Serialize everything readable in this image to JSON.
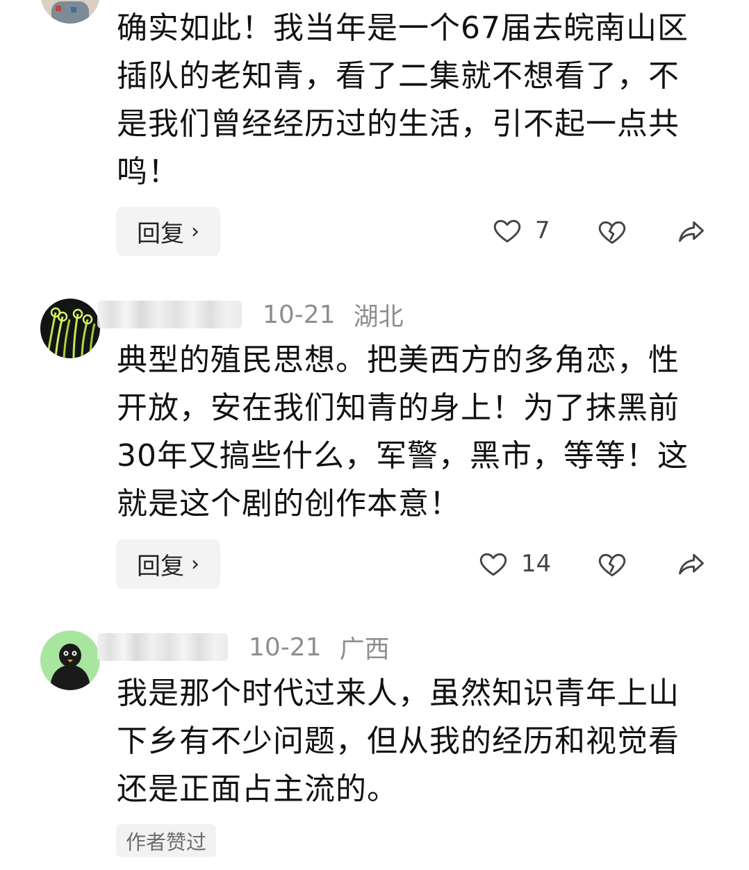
{
  "comments": [
    {
      "text": "确实如此！我当年是一个67届去皖南山区插队的老知青，看了二集就不想看了，不是我们曾经经历过的生活，引不起一点共鸣！",
      "reply_label": "回复",
      "reply_chevron": "›",
      "likes": "7"
    },
    {
      "date": "10-21",
      "location": "湖北",
      "text": "典型的殖民思想。把美西方的多角恋，性开放，安在我们知青的身上！为了抹黑前30年又搞些什么，军警，黑市，等等！这就是这个剧的创作本意！",
      "reply_label": "回复",
      "reply_chevron": "›",
      "likes": "14"
    },
    {
      "date": "10-21",
      "location": "广西",
      "text": "我是那个时代过来人，虽然知识青年上山下乡有不少问题，但从我的经历和视觉看还是正面占主流的。",
      "author_liked_badge": "作者赞过"
    }
  ],
  "icons": {
    "like": "heart-outline-icon",
    "dislike": "broken-heart-icon",
    "share": "share-arrow-icon"
  },
  "colors": {
    "text": "#111111",
    "meta": "#8e8e8e",
    "icon": "#444444",
    "button_bg": "#f3f3f3"
  }
}
